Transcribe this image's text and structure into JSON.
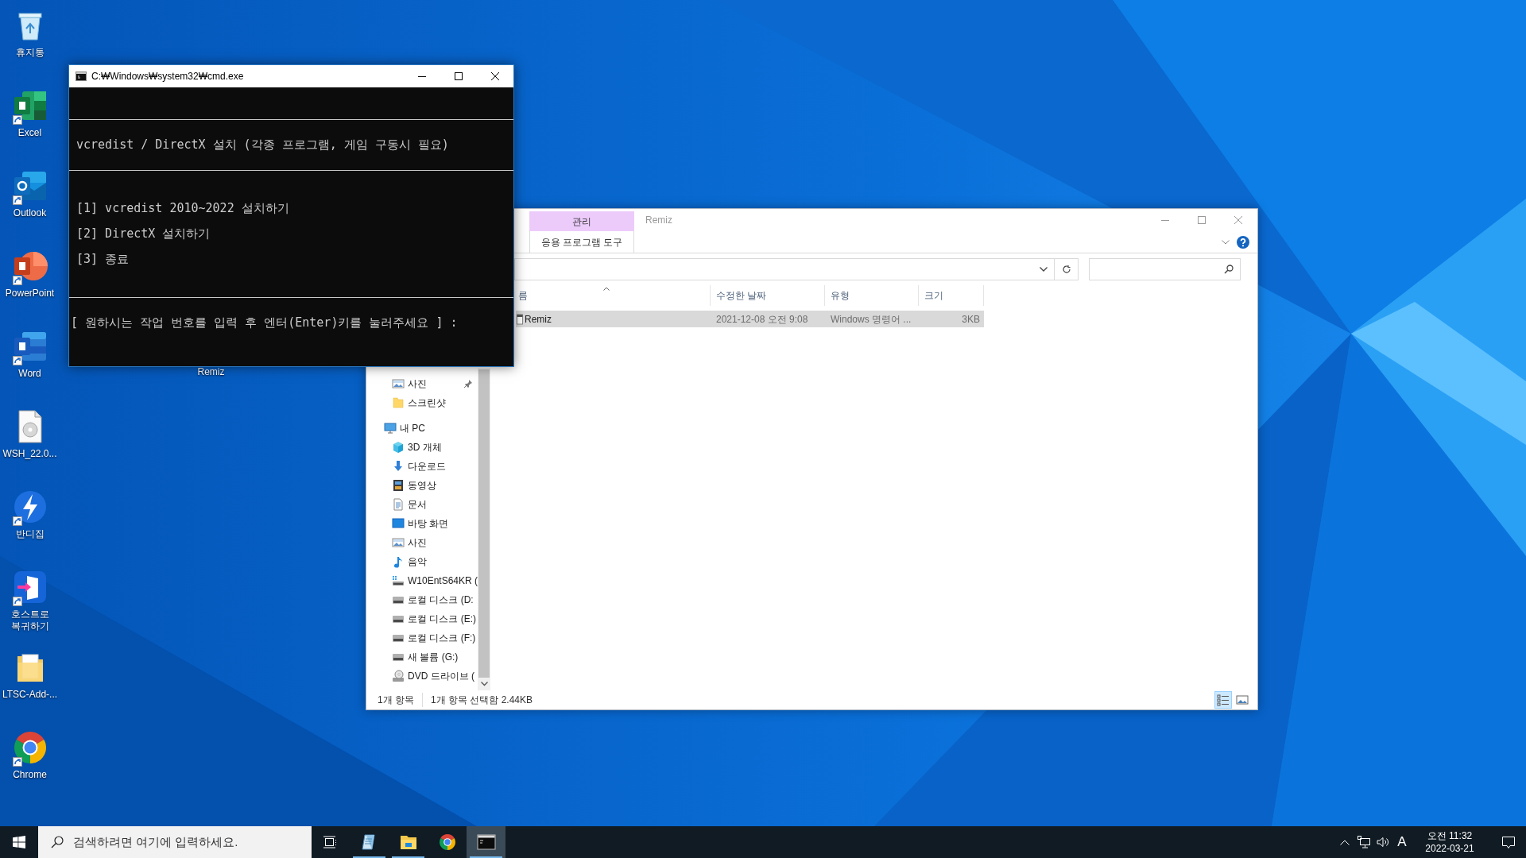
{
  "desktop": {
    "icons": [
      {
        "label": "휴지통",
        "kind": "recycle",
        "shortcut": false
      },
      {
        "label": "Excel",
        "kind": "excel",
        "shortcut": true
      },
      {
        "label": "Outlook",
        "kind": "outlook",
        "shortcut": true
      },
      {
        "label": "PowerPoint",
        "kind": "powerpoint",
        "shortcut": true
      },
      {
        "label": "Word",
        "kind": "word",
        "shortcut": true
      },
      {
        "label": "WSH_22.0...",
        "kind": "disc-file",
        "shortcut": false
      },
      {
        "label": "반디집",
        "kind": "bandizip",
        "shortcut": true
      },
      {
        "label": "호스트로 복귀하기",
        "kind": "host",
        "shortcut": true
      },
      {
        "label": "LTSC-Add-...",
        "kind": "folder-file",
        "shortcut": false
      },
      {
        "label": "Chrome",
        "kind": "chrome",
        "shortcut": true
      }
    ],
    "covered_icon_label": "Remiz"
  },
  "cmd_window": {
    "title": "C:₩Windows₩system32₩cmd.exe",
    "sections": [
      {
        "lines": [
          "vcredist / DirectX 설치 (각종 프로그램, 게임 구동시 필요)"
        ]
      },
      {
        "lines": [
          "[1] vcredist 2010~2022 설치하기",
          "[2] DirectX 설치하기",
          "[3] 종료"
        ]
      },
      {
        "lines": [
          "[ 원하시는 작업 번호를 입력 후 엔터(Enter)키를 눌러주세요 ] :"
        ]
      }
    ]
  },
  "explorer": {
    "title": "Remiz",
    "context_tab": {
      "label": "관리",
      "group": "응용 프로그램 도구"
    },
    "nav": {
      "quick_access_items": [
        {
          "label": "사진",
          "kind": "pictures",
          "pinned": true
        },
        {
          "label": "스크린샷",
          "kind": "folder",
          "pinned": false
        }
      ],
      "this_pc": {
        "label": "내 PC",
        "kind": "pc",
        "children": [
          {
            "label": "3D 개체",
            "kind": "cube"
          },
          {
            "label": "다운로드",
            "kind": "download"
          },
          {
            "label": "동영상",
            "kind": "video"
          },
          {
            "label": "문서",
            "kind": "documents"
          },
          {
            "label": "바탕 화면",
            "kind": "desktop"
          },
          {
            "label": "사진",
            "kind": "pictures"
          },
          {
            "label": "음악",
            "kind": "music"
          },
          {
            "label": "W10EntS64KR (",
            "kind": "drive-windows"
          },
          {
            "label": "로컬 디스크 (D:",
            "kind": "drive"
          },
          {
            "label": "로컬 디스크 (E:)",
            "kind": "drive"
          },
          {
            "label": "로컬 디스크 (F:)",
            "kind": "drive"
          },
          {
            "label": "새 볼륨 (G:)",
            "kind": "drive"
          },
          {
            "label": "DVD 드라이브 (",
            "kind": "dvd"
          }
        ]
      }
    },
    "columns": [
      "름",
      "수정한 날짜",
      "유형",
      "크기"
    ],
    "rows": [
      {
        "name": "Remiz",
        "modified": "2021-12-08 오전 9:08",
        "type": "Windows 명령어 ...",
        "size": "3KB",
        "selected": true
      }
    ],
    "status_bar": {
      "item_count": "1개 항목",
      "selection": "1개 항목 선택함 2.44KB"
    },
    "view_buttons": [
      {
        "kind": "details",
        "selected": true
      },
      {
        "kind": "large-icons",
        "selected": false
      }
    ]
  },
  "taskbar": {
    "search_placeholder": "검색하려면 여기에 입력하세요.",
    "apps": [
      {
        "kind": "notepad",
        "running": true,
        "active": false
      },
      {
        "kind": "explorer",
        "running": true,
        "active": false
      },
      {
        "kind": "chrome",
        "running": false,
        "active": false
      },
      {
        "kind": "cmd",
        "running": true,
        "active": true
      }
    ],
    "tray": {
      "input_mode": "A",
      "time": "오전 11:32",
      "date": "2022-03-21"
    }
  }
}
